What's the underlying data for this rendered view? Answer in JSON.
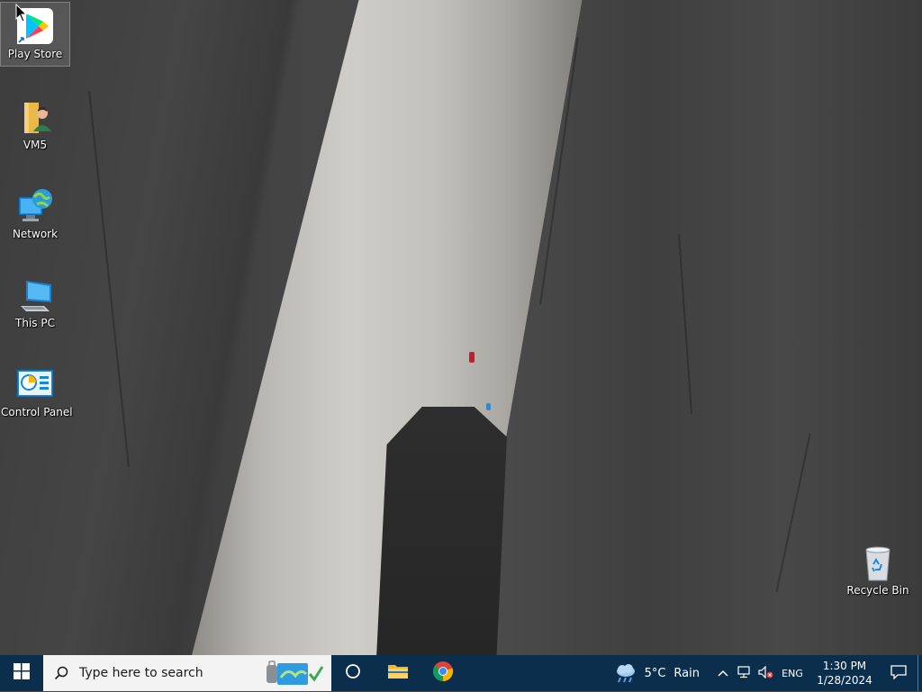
{
  "desktop": {
    "icons": [
      {
        "label": "Play Store"
      },
      {
        "label": "VM5"
      },
      {
        "label": "Network"
      },
      {
        "label": "This PC"
      },
      {
        "label": "Control Panel"
      },
      {
        "label": "Recycle Bin"
      }
    ]
  },
  "taskbar": {
    "search_placeholder": "Type here to search",
    "weather": {
      "temp": "5°C",
      "condition": "Rain"
    },
    "language": "ENG",
    "clock": {
      "time": "1:30 PM",
      "date": "1/28/2024"
    }
  },
  "colors": {
    "taskbar": "#0b2e4d",
    "search_bg": "#f3f3f3",
    "accent": "#0078d7"
  }
}
